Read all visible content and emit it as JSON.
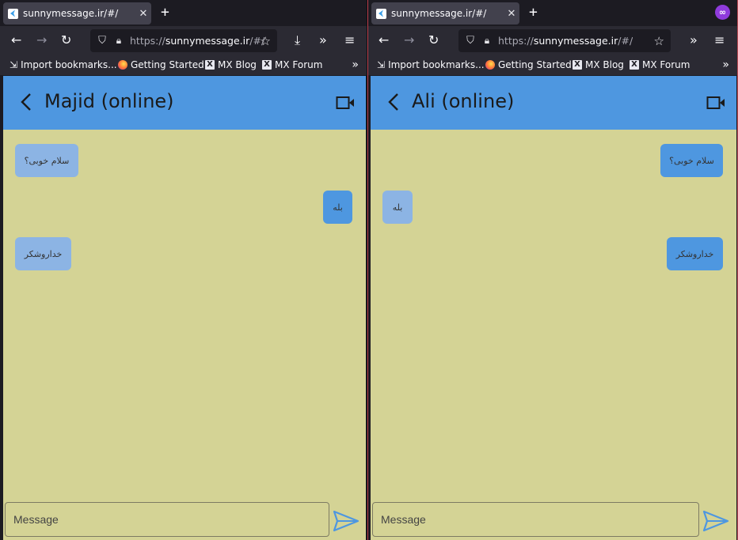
{
  "windows": [
    {
      "tab_title": "sunnymessage.ir/#/",
      "url_protocol": "https://",
      "url_host": "sunnymessage.ir",
      "url_path": "/#/",
      "bookmarks": [
        {
          "label": "Import bookmarks...",
          "icon": "import-icon"
        },
        {
          "label": "Getting Started",
          "icon": "firefox-icon"
        },
        {
          "label": "MX Blog",
          "icon": "mx-icon"
        },
        {
          "label": "MX Forum",
          "icon": "mx-icon"
        }
      ],
      "chat_title": "Majid (online)",
      "messages": [
        {
          "text": "سلام خوبی؟",
          "side": "incoming"
        },
        {
          "text": "بله",
          "side": "outgoing"
        },
        {
          "text": "خداروشکر",
          "side": "incoming"
        }
      ],
      "input_placeholder": "Message"
    },
    {
      "tab_title": "sunnymessage.ir/#/",
      "url_protocol": "https://",
      "url_host": "sunnymessage.ir",
      "url_path": "/#/",
      "bookmarks": [
        {
          "label": "Import bookmarks...",
          "icon": "import-icon"
        },
        {
          "label": "Getting Started",
          "icon": "firefox-icon"
        },
        {
          "label": "MX Blog",
          "icon": "mx-icon"
        },
        {
          "label": "MX Forum",
          "icon": "mx-icon"
        }
      ],
      "chat_title": "Ali (online)",
      "messages": [
        {
          "text": "سلام خوبی؟",
          "side": "outgoing"
        },
        {
          "text": "بله",
          "side": "incoming"
        },
        {
          "text": "خداروشکر",
          "side": "outgoing"
        }
      ],
      "input_placeholder": "Message"
    }
  ],
  "colors": {
    "appbar": "#4e97e0",
    "chat_background": "#d4d395",
    "bubble_incoming": "#8cb4e4",
    "bubble_outgoing": "#4e97e0",
    "browser_chrome": "#2b2a33"
  }
}
